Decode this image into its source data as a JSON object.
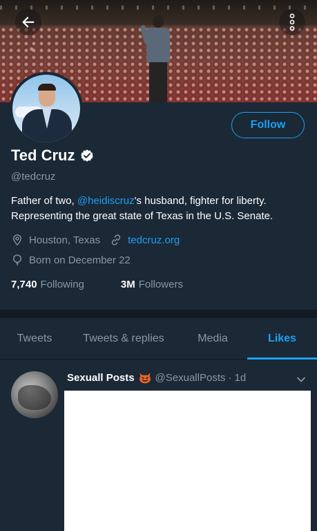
{
  "header": {
    "back_icon": "arrow-left-icon",
    "more_icon": "vertical-dots-icon"
  },
  "profile": {
    "display_name": "Ted Cruz",
    "verified": true,
    "handle": "@tedcruz",
    "follow_label": "Follow",
    "bio": {
      "prefix": "Father of two, ",
      "mention": "@heidiscruz",
      "suffix": "'s husband, fighter for liberty. Representing the great state of Texas in the U.S. Senate."
    },
    "location": "Houston, Texas",
    "website": "tedcruz.org",
    "birth": "Born on December 22",
    "following_count": "7,740",
    "following_label": "Following",
    "followers_count": "3M",
    "followers_label": "Followers"
  },
  "tabs": [
    {
      "label": "Tweets",
      "active": false
    },
    {
      "label": "Tweets & replies",
      "active": false
    },
    {
      "label": "Media",
      "active": false
    },
    {
      "label": "Likes",
      "active": true
    }
  ],
  "tweet": {
    "author": "Sexuall Posts",
    "handle": "@SexuallPosts",
    "separator": "·",
    "time": "1d"
  },
  "colors": {
    "background": "#1b2836",
    "accent": "#1da1f2",
    "secondary_text": "#8899a6",
    "divider": "#121a24"
  }
}
